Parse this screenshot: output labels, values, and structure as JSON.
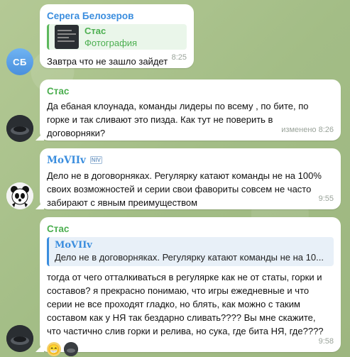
{
  "messages": [
    {
      "sender": "Серега Белозеров",
      "sender_color": "#3a8dde",
      "avatar_initials": "СБ",
      "reply": {
        "name": "Стас",
        "text": "Фотография"
      },
      "text": "Завтра что не зашло зайдет",
      "time": "8:25"
    },
    {
      "sender": "Стас",
      "sender_color": "#4caf50",
      "text": "Да ебаная клоунада, команды лидеры по всему , по бите, по горке и так сливают это пизда. Как тут не поверить в договорняки?",
      "time": "изменено 8:26"
    },
    {
      "sender": "MoVIIv",
      "sender_color": "#3a8dde",
      "sender_badge": "NIV",
      "text": "Дело не в договорняках. Регулярку катают команды не на 100% своих возможностей и серии свои фавориты совсем не часто забирают с явным преимуществом",
      "time": "9:55"
    },
    {
      "sender": "Стас",
      "sender_color": "#4caf50",
      "reply": {
        "name": "MoVIIv",
        "text": "Дело не в договорняках. Регулярку катают команды не на 10..."
      },
      "text": "тогда от чего отталкиваться в регулярке как не от статы, горки и составов? я прекрасно понимаю, что игры ежедневные и что серии не все проходят гладко, но блять, как можно с таким составом как у НЯ так бездарно сливать???? Вы мне скажите, что частично слив горки и релива, но сука, где бита НЯ, где????",
      "time": "9:58",
      "reactions": [
        "😁",
        "user"
      ]
    }
  ]
}
